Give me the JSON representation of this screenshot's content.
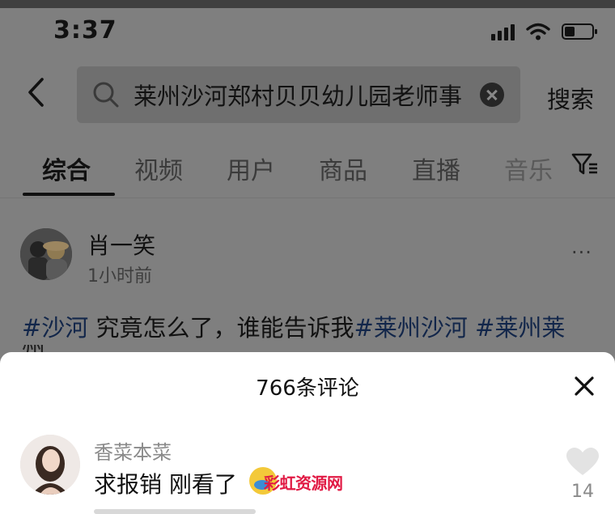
{
  "status_bar": {
    "time": "3:37"
  },
  "search": {
    "query": "莱州沙河郑村贝贝幼儿园老师事",
    "submit_label": "搜索"
  },
  "tabs": [
    "综合",
    "视频",
    "用户",
    "商品",
    "直播",
    "音乐"
  ],
  "active_tab": "综合",
  "post": {
    "author": "肖一笑",
    "time_ago": "1小时前",
    "more_label": "···",
    "text_tag1": "#沙河",
    "text_body": " 究竟怎么了，谁能告诉我",
    "text_tag2": "#莱州沙河",
    "text_tag3": " #莱州莱",
    "text_cut": "州"
  },
  "comments_sheet": {
    "title": "766条评论",
    "comment": {
      "author": "香菜本菜",
      "text": "求报销 刚看了",
      "likes": "14"
    },
    "watermark": "彩虹资源网"
  },
  "colors": {
    "tag_blue": "#12264a",
    "watermark_red": "#e11a44"
  },
  "icons": [
    "back-arrow-icon",
    "search-icon",
    "clear-icon",
    "filter-icon",
    "more-icon",
    "close-icon",
    "heart-icon",
    "signal-icon",
    "wifi-icon",
    "battery-icon"
  ]
}
